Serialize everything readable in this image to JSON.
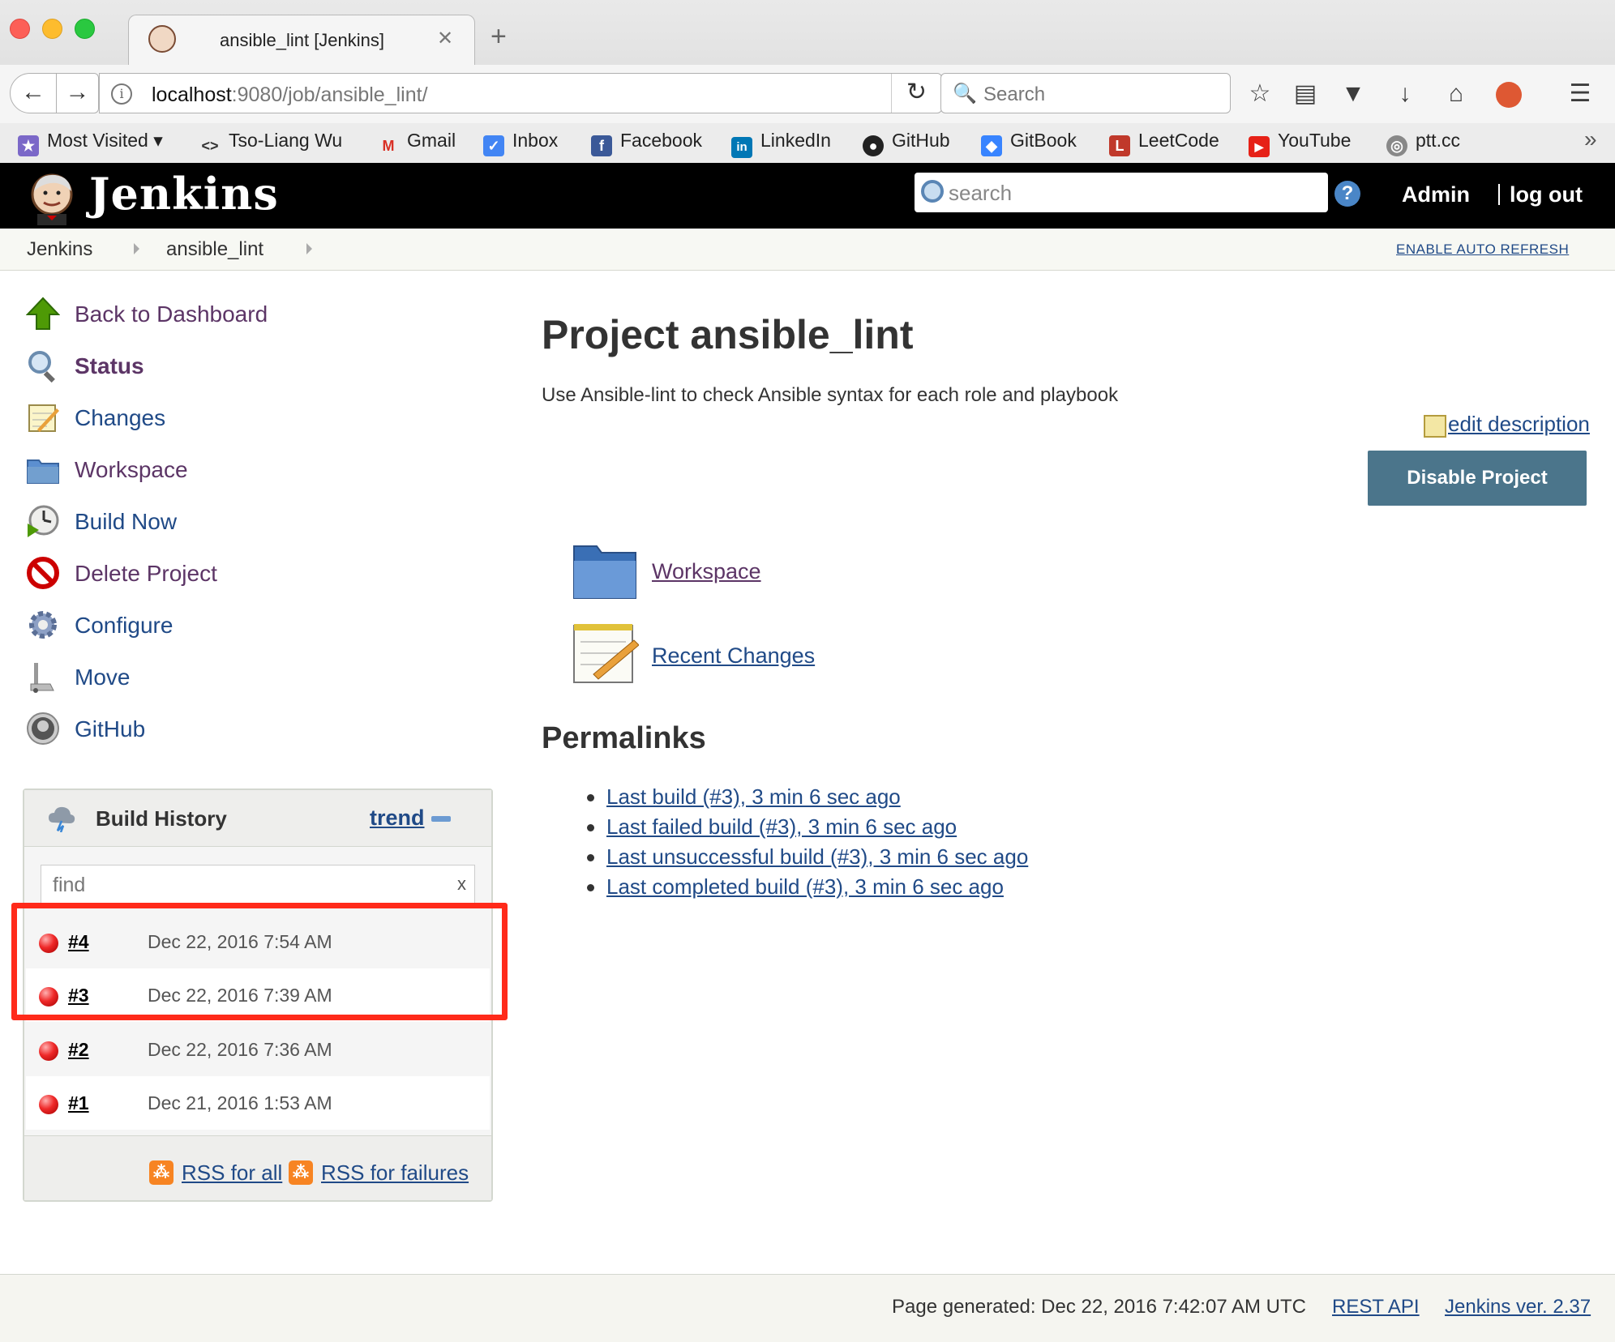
{
  "browser": {
    "tab_title": "ansible_lint [Jenkins]",
    "tab_close": "✕",
    "new_tab": "+",
    "url_host": "localhost",
    "url_rest": ":9080/job/ansible_lint/",
    "search_placeholder": "Search",
    "bookmarks": [
      {
        "label": "Most Visited ▾",
        "icon": "star-folder-icon",
        "color": "#6a5acd"
      },
      {
        "label": "Tso-Liang Wu",
        "icon": "code-icon",
        "color": "#444"
      },
      {
        "label": "Gmail",
        "icon": "gmail-icon",
        "color": "#d93025"
      },
      {
        "label": "Inbox",
        "icon": "inbox-icon",
        "color": "#4285f4"
      },
      {
        "label": "Facebook",
        "icon": "facebook-icon",
        "color": "#3b5998"
      },
      {
        "label": "LinkedIn",
        "icon": "linkedin-icon",
        "color": "#0077b5"
      },
      {
        "label": "GitHub",
        "icon": "github-icon",
        "color": "#222"
      },
      {
        "label": "GitBook",
        "icon": "gitbook-icon",
        "color": "#3884ff"
      },
      {
        "label": "LeetCode",
        "icon": "leetcode-icon",
        "color": "#c0392b"
      },
      {
        "label": "YouTube",
        "icon": "youtube-icon",
        "color": "#e62117"
      },
      {
        "label": "ptt.cc",
        "icon": "globe-icon",
        "color": "#777"
      }
    ],
    "overflow": "»"
  },
  "jenkins": {
    "title": "Jenkins",
    "search_placeholder": "search",
    "help": "?",
    "user": "Admin",
    "logout": "log out"
  },
  "breadcrumb": {
    "items": [
      "Jenkins",
      "ansible_lint"
    ],
    "auto_refresh": "ENABLE AUTO REFRESH"
  },
  "sidepanel": {
    "tasks": [
      {
        "label": "Back to Dashboard",
        "icon": "up-arrow-icon"
      },
      {
        "label": "Status",
        "icon": "magnifier-icon"
      },
      {
        "label": "Changes",
        "icon": "notepad-icon"
      },
      {
        "label": "Workspace",
        "icon": "folder-icon"
      },
      {
        "label": "Build Now",
        "icon": "clock-play-icon"
      },
      {
        "label": "Delete Project",
        "icon": "no-entry-icon"
      },
      {
        "label": "Configure",
        "icon": "gear-icon"
      },
      {
        "label": "Move",
        "icon": "move-icon"
      },
      {
        "label": "GitHub",
        "icon": "github-icon"
      }
    ]
  },
  "build_history": {
    "title": "Build History",
    "trend": "trend",
    "filter_placeholder": "find",
    "filter_clear": "x",
    "builds": [
      {
        "number": "#4",
        "date": "Dec 22, 2016 7:54 AM",
        "status": "failed"
      },
      {
        "number": "#3",
        "date": "Dec 22, 2016 7:39 AM",
        "status": "failed"
      },
      {
        "number": "#2",
        "date": "Dec 22, 2016 7:36 AM",
        "status": "failed"
      },
      {
        "number": "#1",
        "date": "Dec 21, 2016 1:53 AM",
        "status": "failed"
      }
    ],
    "rss_all": "RSS for all",
    "rss_failures": "RSS for failures"
  },
  "main": {
    "title": "Project ansible_lint",
    "description": "Use Ansible-lint to check Ansible syntax for each role and playbook",
    "edit_description": "edit description",
    "disable_button": "Disable Project",
    "workspace_link": "Workspace",
    "recent_changes_link": "Recent Changes",
    "permalinks_title": "Permalinks",
    "permalinks": [
      "Last build (#3), 3 min 6 sec ago",
      "Last failed build (#3), 3 min 6 sec ago",
      "Last unsuccessful build (#3), 3 min 6 sec ago",
      "Last completed build (#3), 3 min 6 sec ago"
    ]
  },
  "footer": {
    "page_generated": "Page generated: Dec 22, 2016 7:42:07 AM UTC",
    "rest_api": "REST API",
    "version": "Jenkins ver. 2.37"
  },
  "colors": {
    "highlight": "#ff2a1a",
    "jenkins_header": "#000000",
    "disable_button": "#4b758b",
    "link": "#204a87",
    "visited_link": "#5c3566"
  }
}
